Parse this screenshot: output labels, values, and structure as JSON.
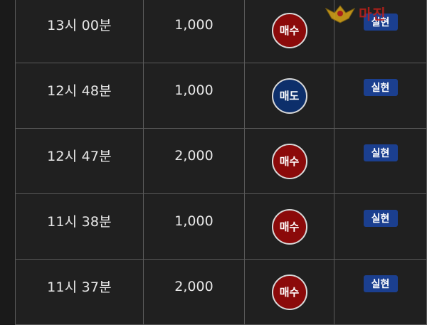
{
  "rows": [
    {
      "time": "13시 00분",
      "quantity": "1,000",
      "side": "매수",
      "side_type": "buy",
      "status": "실현"
    },
    {
      "time": "12시 48분",
      "quantity": "1,000",
      "side": "매도",
      "side_type": "sell",
      "status": "실현"
    },
    {
      "time": "12시 47분",
      "quantity": "2,000",
      "side": "매수",
      "side_type": "buy",
      "status": "실현"
    },
    {
      "time": "11시 38분",
      "quantity": "1,000",
      "side": "매수",
      "side_type": "buy",
      "status": "실현"
    },
    {
      "time": "11시 37분",
      "quantity": "2,000",
      "side": "매수",
      "side_type": "buy",
      "status": "실현"
    }
  ],
  "watermark": {
    "logo_text": "마진",
    "subtitle": ""
  },
  "colors": {
    "buy": "#8b0a0a",
    "sell": "#0d2f6b",
    "status": "#1b3f8f",
    "background": "#202020"
  }
}
